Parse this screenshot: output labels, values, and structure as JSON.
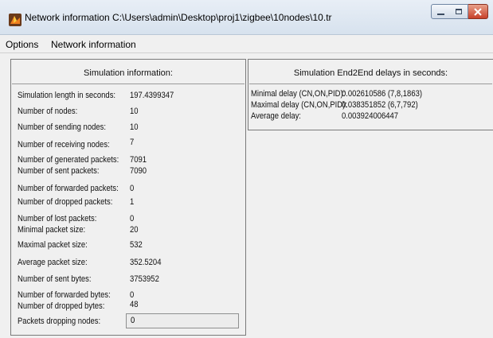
{
  "window": {
    "title": "Network information  C:\\Users\\admin\\Desktop\\proj1\\zigbee\\10nodes\\10.tr",
    "icon": "matlab-icon",
    "buttons": [
      "minimize-icon",
      "maximize-icon",
      "close-icon"
    ]
  },
  "menu": {
    "items": [
      {
        "label": "Options"
      },
      {
        "label": "Network information"
      }
    ]
  },
  "simulation": {
    "title": "Simulation information:",
    "rows": [
      {
        "label": "Simulation length in seconds:",
        "value": "197.4399347"
      },
      {
        "label": "Number of nodes:",
        "value": "10"
      },
      {
        "label": "Number of sending nodes:",
        "value": "10"
      },
      {
        "label": "Number of receiving nodes:",
        "value": "7"
      },
      {
        "label": "Number of generated packets:",
        "value": "7091"
      },
      {
        "label": "Number of sent packets:",
        "value": "7090"
      },
      {
        "label": "Number of forwarded packets:",
        "value": "0"
      },
      {
        "label": "Number of dropped packets:",
        "value": "1"
      },
      {
        "label": "Number of lost packets:",
        "value": "0"
      },
      {
        "label": "Minimal packet size:",
        "value": "20"
      },
      {
        "label": "Maximal packet size:",
        "value": "532"
      },
      {
        "label": "Average packet size:",
        "value": "352.5204"
      },
      {
        "label": "Number of sent bytes:",
        "value": "3753952"
      },
      {
        "label": "Number of forwarded bytes:",
        "value": "0"
      },
      {
        "label": "Number of dropped bytes:",
        "value": "48"
      }
    ],
    "dropping_nodes": {
      "label": "Packets dropping nodes:",
      "value": "0"
    }
  },
  "delays": {
    "title": "Simulation End2End delays in seconds:",
    "rows": [
      {
        "label": "Minimal delay (CN,ON,PID):",
        "value": "0.002610586 (7,8,1863)"
      },
      {
        "label": "Maximal delay (CN,ON,PID):",
        "value": "0.038351852 (6,7,792)"
      },
      {
        "label": "Average delay:",
        "value": "0.003924006447"
      }
    ]
  },
  "colors": {
    "window_bg": "#f0f0f0",
    "titlebar": "#d7e2ee",
    "close_button": "#c8412a",
    "panel_border": "#7a7a7a"
  }
}
